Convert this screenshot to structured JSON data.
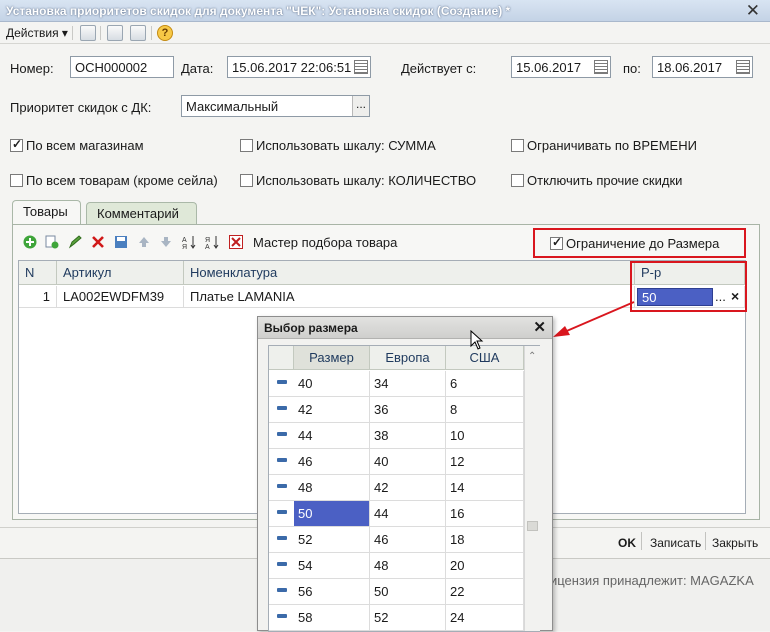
{
  "window": {
    "title": "Установка приоритетов скидок для документа \"ЧЕК\": Установка скидок (Создание) *",
    "close": "✕"
  },
  "toolbar": {
    "actions_label": "Действия",
    "icons": [
      "copy-icon",
      "form-icon",
      "refresh-icon",
      "help-icon"
    ],
    "help_glyph": "?"
  },
  "form": {
    "number_label": "Номер:",
    "number_value": "ОСН000002",
    "date_label": "Дата:",
    "date_value": "15.06.2017 22:06:51",
    "valid_from_label": "Действует с:",
    "valid_from_value": "15.06.2017",
    "valid_to_label": "по:",
    "valid_to_value": "18.06.2017",
    "priority_label": "Приоритет скидок с ДК:",
    "priority_value": "Максимальный",
    "ellipsis": "..."
  },
  "checkboxes": [
    {
      "label": "По всем магазинам",
      "checked": true
    },
    {
      "label": "Использовать шкалу: СУММА",
      "checked": false
    },
    {
      "label": "Ограничивать по ВРЕМЕНИ",
      "checked": false
    },
    {
      "label": "По всем товарам (кроме сейла)",
      "checked": false
    },
    {
      "label": "Использовать шкалу: КОЛИЧЕСТВО",
      "checked": false
    },
    {
      "label": "Отключить прочие скидки",
      "checked": false
    }
  ],
  "tabs": [
    {
      "label": "Товары",
      "active": true
    },
    {
      "label": "Комментарий",
      "active": false
    }
  ],
  "goods_toolbar": {
    "wizard_label": "Мастер подбора товара",
    "size_limit_label": "Ограничение до Размера",
    "size_limit_checked": true
  },
  "goods_table": {
    "columns": [
      "N",
      "Артикул",
      "Номенклатура",
      "Р-р"
    ],
    "rows": [
      {
        "n": "1",
        "article": "LA002EWDFM39",
        "name": "Платье LAMANIA",
        "size": "50"
      }
    ],
    "cell_clear": "×"
  },
  "footer": {
    "ok": "OK",
    "save": "Записать",
    "close": "Закрыть",
    "license": "ицензия принадлежит: MAGAZKA"
  },
  "size_popup": {
    "title": "Выбор размера",
    "close": "✕",
    "columns": [
      "Размер",
      "Европа",
      "США"
    ],
    "rows": [
      [
        "40",
        "34",
        "6"
      ],
      [
        "42",
        "36",
        "8"
      ],
      [
        "44",
        "38",
        "10"
      ],
      [
        "46",
        "40",
        "12"
      ],
      [
        "48",
        "42",
        "14"
      ],
      [
        "50",
        "44",
        "16"
      ],
      [
        "52",
        "46",
        "18"
      ],
      [
        "54",
        "48",
        "20"
      ],
      [
        "56",
        "50",
        "22"
      ],
      [
        "58",
        "52",
        "24"
      ]
    ],
    "selected_row": 5
  },
  "colors": {
    "highlight_red": "#d9161e",
    "selection_blue": "#4b60c4"
  }
}
